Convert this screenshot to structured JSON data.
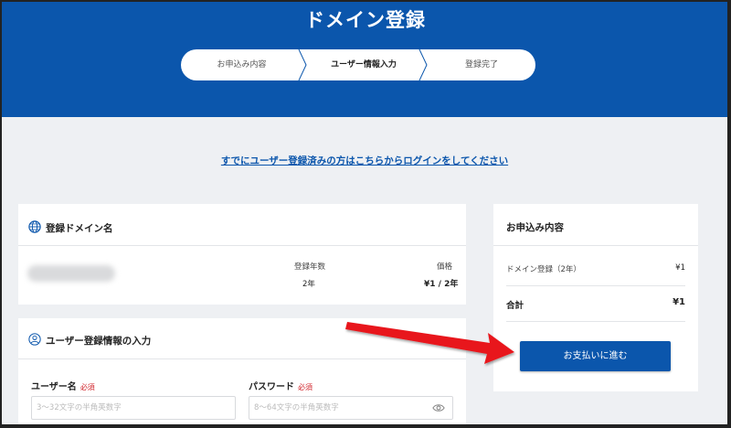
{
  "header": {
    "title": "ドメイン登録",
    "steps": [
      "お申込み内容",
      "ユーザー情報入力",
      "登録完了"
    ],
    "active_step": 1
  },
  "login_link": "すでにユーザー登録済みの方はこちらからログインをしてください",
  "domain_section": {
    "title": "登録ドメイン名",
    "col_years_label": "登録年数",
    "col_price_label": "価格",
    "years_value": "2年",
    "price_value": "¥1 / 2年"
  },
  "user_section": {
    "title": "ユーザー登録情報の入力",
    "username_label": "ユーザー名",
    "password_label": "パスワード",
    "required_badge": "必須",
    "username_placeholder": "3～32文字の半角英数字",
    "password_placeholder": "8～64文字の半角英数字"
  },
  "summary": {
    "title": "お申込み内容",
    "item_label": "ドメイン登録（2年）",
    "item_price": "¥1",
    "total_label": "合計",
    "total_price": "¥1",
    "pay_button": "お支払いに進む"
  },
  "colors": {
    "brand": "#0b56ac",
    "required": "#d0232a",
    "annotation_arrow": "#e8151b"
  }
}
